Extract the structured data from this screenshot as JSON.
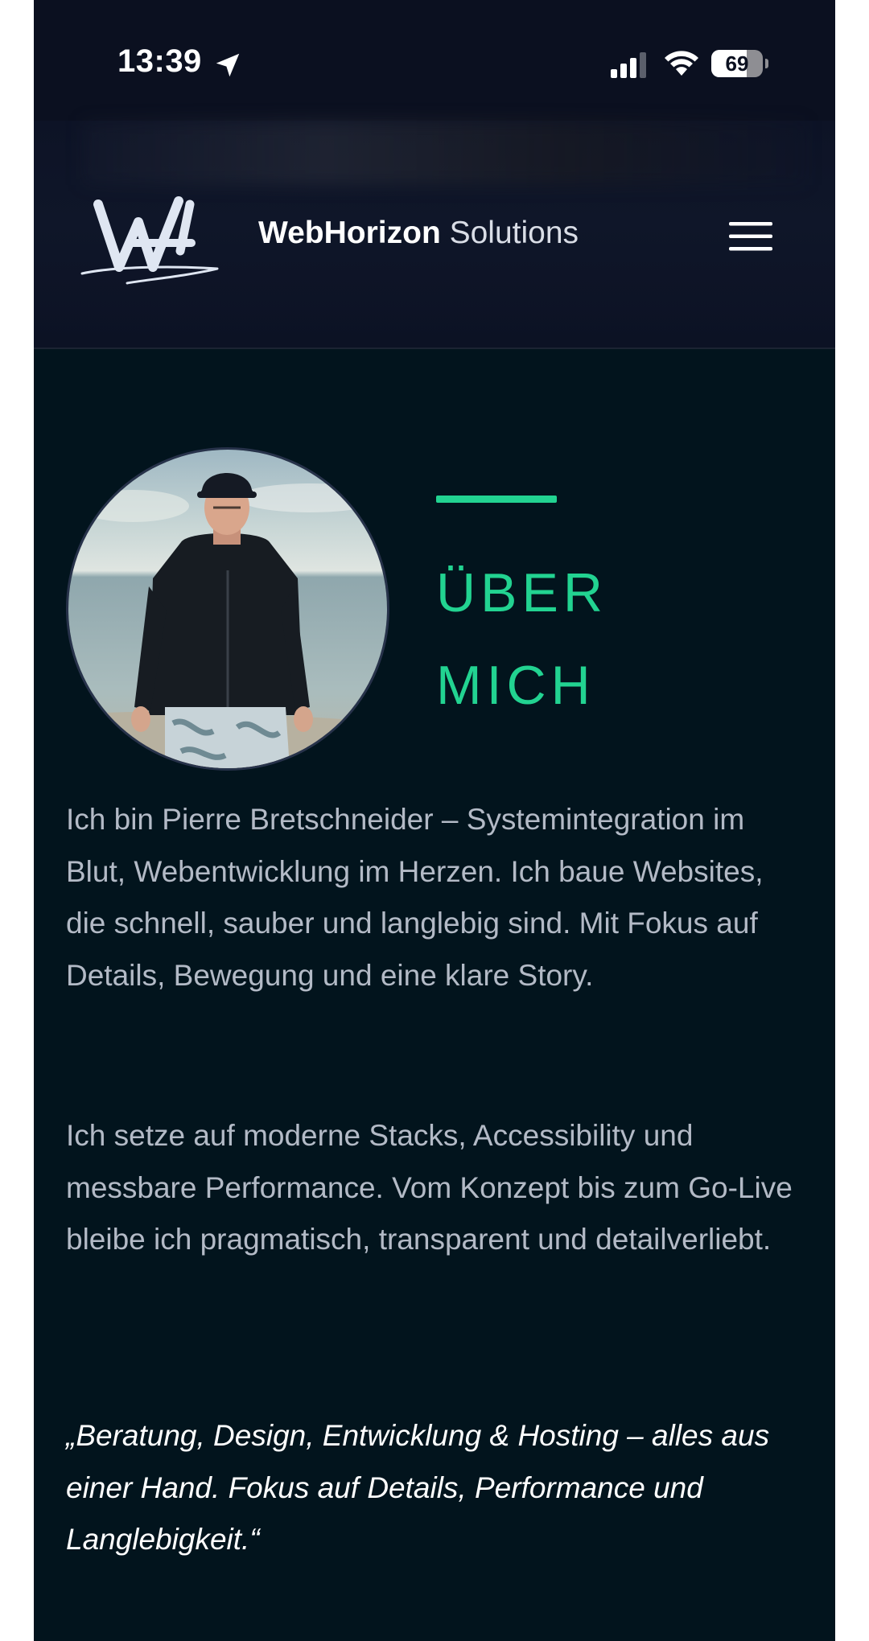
{
  "status_bar": {
    "time": "13:39",
    "battery_percent": 69,
    "battery_text": "69",
    "icons": [
      "location-arrow-icon",
      "cellular-signal-icon",
      "wifi-icon",
      "battery-icon"
    ]
  },
  "header": {
    "brand_strong": "WebHorizon",
    "brand_light": "Solutions",
    "menu_icon": "hamburger-menu-icon"
  },
  "about": {
    "title_line1": "ÜBER",
    "title_line2": "MICH",
    "accent_color": "#22d391",
    "paragraph1": "Ich bin Pierre Bretschneider – Systemintegration im Blut, Webentwicklung im Herzen. Ich baue Websites, die schnell, sauber und langlebig sind. Mit Fokus auf Details, Bewegung und eine klare Story.",
    "paragraph2": "Ich setze auf moderne Stacks, Accessibility und messbare Performance. Vom Konzept bis zum Go-Live bleibe ich pragmatisch, transparent und detailverliebt.",
    "quote": "„Beratung, Design, Entwicklung & Hosting – alles aus einer Hand. Fokus auf Details, Performance und Langlebigkeit.“"
  },
  "colors": {
    "page_background": "#02141d",
    "header_background": "#0d1326",
    "body_text": "#b3bac6"
  }
}
